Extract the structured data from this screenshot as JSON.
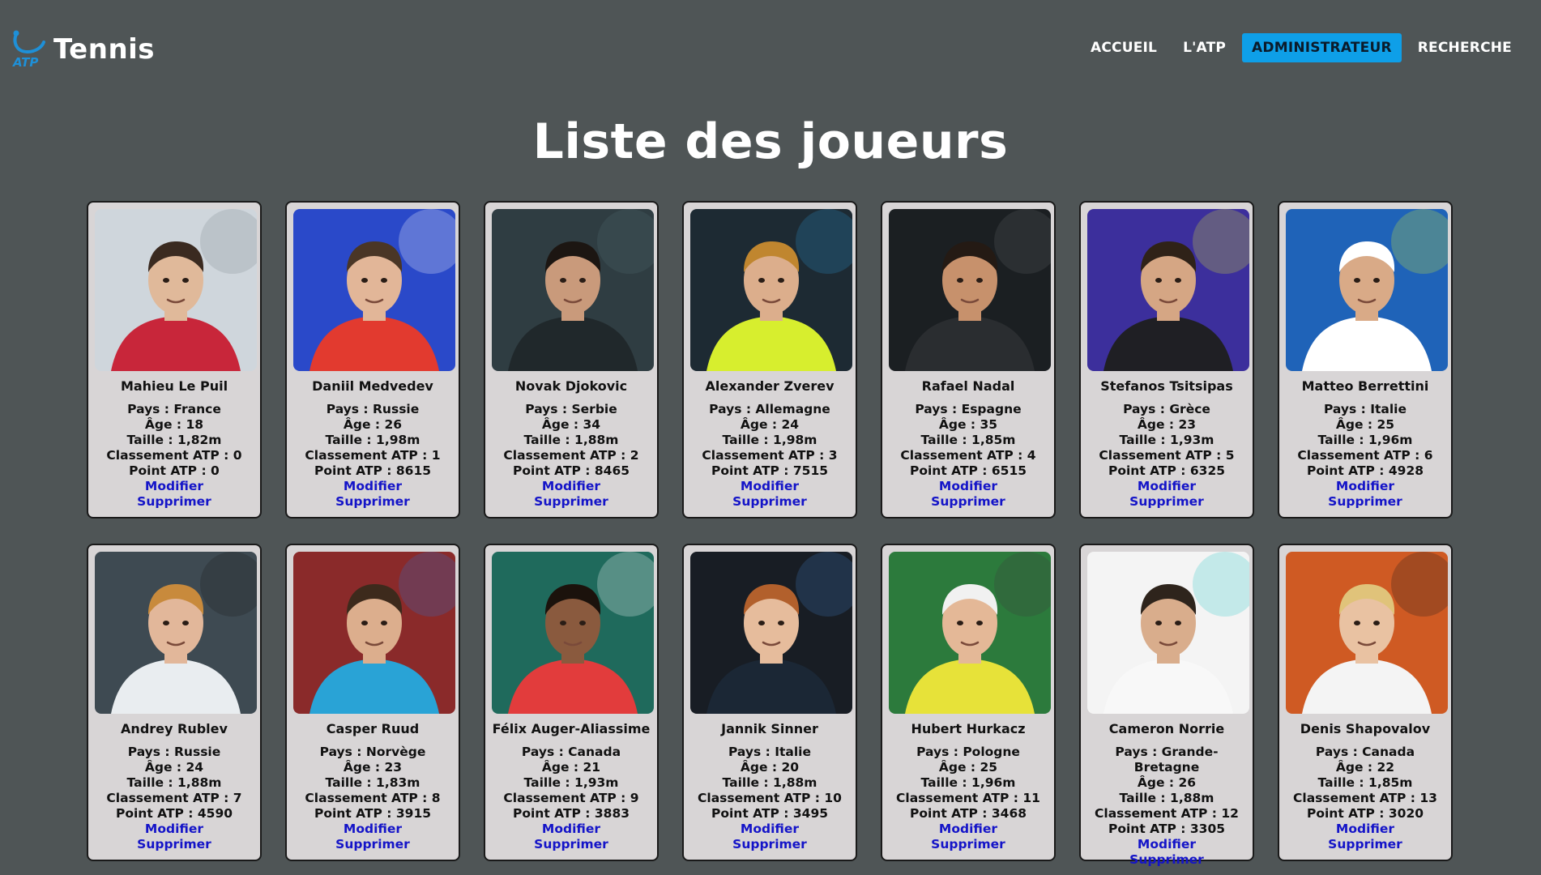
{
  "header": {
    "logo_label": "ATP",
    "logo_text": "Tennis",
    "nav": [
      {
        "label": "ACCUEIL",
        "active": false
      },
      {
        "label": "L'ATP",
        "active": false
      },
      {
        "label": "ADMINISTRATEUR",
        "active": true
      },
      {
        "label": "RECHERCHE",
        "active": false
      }
    ]
  },
  "page_title": "Liste des joueurs",
  "labels": {
    "pays": "Pays : ",
    "age": "Âge : ",
    "taille": "Taille : ",
    "classement": "Classement ATP : ",
    "points": "Point ATP : ",
    "modifier": "Modifier",
    "supprimer": "Supprimer"
  },
  "players": [
    {
      "name": "Mahieu Le Puil",
      "pays": "France",
      "age": "18",
      "taille": "1,82m",
      "classement": "0",
      "points": "0",
      "photo_bg": "#cfd6dc",
      "shirt": "#c8263a",
      "skin": "#e0b99a",
      "hair": "#3a2a20",
      "accent": "#7e8a8f"
    },
    {
      "name": "Daniil Medvedev",
      "pays": "Russie",
      "age": "26",
      "taille": "1,98m",
      "classement": "1",
      "points": "8615",
      "photo_bg": "#2a49c9",
      "shirt": "#e23a2f",
      "skin": "#e2b698",
      "hair": "#4a3626",
      "accent": "#ffffff"
    },
    {
      "name": "Novak Djokovic",
      "pays": "Serbie",
      "age": "34",
      "taille": "1,88m",
      "classement": "2",
      "points": "8465",
      "photo_bg": "#2f3d42",
      "shirt": "#20282b",
      "skin": "#c99a7b",
      "hair": "#1c1612",
      "accent": "#4f6a70"
    },
    {
      "name": "Alexander Zverev",
      "pays": "Allemagne",
      "age": "24",
      "taille": "1,98m",
      "classement": "3",
      "points": "7515",
      "photo_bg": "#1d2a33",
      "shirt": "#d7ee2e",
      "skin": "#dcae8c",
      "hair": "#c0862f",
      "accent": "#2b90c8"
    },
    {
      "name": "Rafael Nadal",
      "pays": "Espagne",
      "age": "35",
      "taille": "1,85m",
      "classement": "4",
      "points": "6515",
      "photo_bg": "#1b1f22",
      "shirt": "#2a2d30",
      "skin": "#c7916c",
      "hair": "#241a14",
      "accent": "#5a5f62"
    },
    {
      "name": "Stefanos Tsitsipas",
      "pays": "Grèce",
      "age": "23",
      "taille": "1,93m",
      "classement": "5",
      "points": "6325",
      "photo_bg": "#3c2f9c",
      "shirt": "#1f1f24",
      "skin": "#d5a684",
      "hair": "#2f2218",
      "accent": "#d7e232"
    },
    {
      "name": "Matteo Berrettini",
      "pays": "Italie",
      "age": "25",
      "taille": "1,96m",
      "classement": "6",
      "points": "4928",
      "photo_bg": "#1f63b8",
      "shirt": "#ffffff",
      "skin": "#d9aa87",
      "hair": "#ffffff",
      "accent": "#d5ea2f"
    },
    {
      "name": "Andrey Rublev",
      "pays": "Russie",
      "age": "24",
      "taille": "1,88m",
      "classement": "7",
      "points": "4590",
      "photo_bg": "#3e4a52",
      "shirt": "#e9edf0",
      "skin": "#e2b79a",
      "hair": "#c88a3c",
      "accent": "#1c1c1c"
    },
    {
      "name": "Casper Ruud",
      "pays": "Norvège",
      "age": "23",
      "taille": "1,83m",
      "classement": "8",
      "points": "3915",
      "photo_bg": "#8a2a2a",
      "shirt": "#29a3d6",
      "skin": "#dcae8d",
      "hair": "#3d2a1c",
      "accent": "#2b6fcc"
    },
    {
      "name": "Félix Auger-Aliassime",
      "pays": "Canada",
      "age": "21",
      "taille": "1,93m",
      "classement": "9",
      "points": "3883",
      "photo_bg": "#1f6a5c",
      "shirt": "#e23c3c",
      "skin": "#8a5a3e",
      "hair": "#1b120c",
      "accent": "#ffffff"
    },
    {
      "name": "Jannik Sinner",
      "pays": "Italie",
      "age": "20",
      "taille": "1,88m",
      "classement": "10",
      "points": "3495",
      "photo_bg": "#181d24",
      "shirt": "#1b2735",
      "skin": "#e6bc9c",
      "hair": "#b2602c",
      "accent": "#3a78b6"
    },
    {
      "name": "Hubert Hurkacz",
      "pays": "Pologne",
      "age": "25",
      "taille": "1,96m",
      "classement": "11",
      "points": "3468",
      "photo_bg": "#2c7a3c",
      "shirt": "#e7e239",
      "skin": "#e4b897",
      "hair": "#f1f1f1",
      "accent": "#3a3a3a"
    },
    {
      "name": "Cameron Norrie",
      "pays": "Grande-Bretagne",
      "age": "26",
      "taille": "1,88m",
      "classement": "12",
      "points": "3305",
      "photo_bg": "#f4f4f4",
      "shirt": "#f8f8f8",
      "skin": "#d9ad8c",
      "hair": "#2e241c",
      "accent": "#31c6c6"
    },
    {
      "name": "Denis Shapovalov",
      "pays": "Canada",
      "age": "22",
      "taille": "1,85m",
      "classement": "13",
      "points": "3020",
      "photo_bg": "#cf5a23",
      "shirt": "#f4f4f4",
      "skin": "#e9c2a2",
      "hair": "#e0c37a",
      "accent": "#1c1c1c"
    }
  ]
}
